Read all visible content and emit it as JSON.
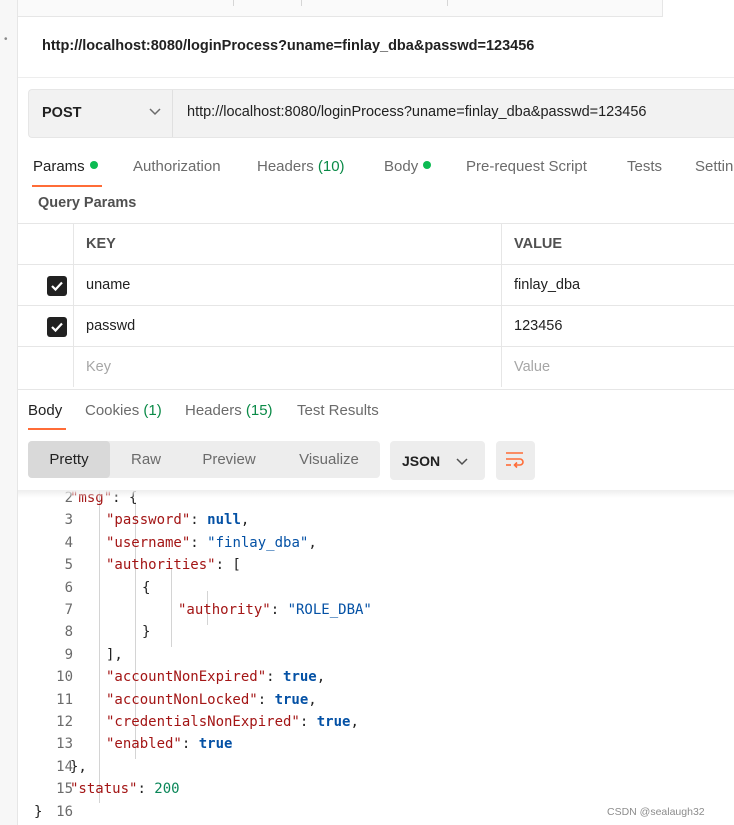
{
  "page": {
    "title_url": "http://localhost:8080/loginProcess?uname=finlay_dba&passwd=123456"
  },
  "request": {
    "method": "POST",
    "url": "http://localhost:8080/loginProcess?uname=finlay_dba&passwd=123456"
  },
  "request_tabs": {
    "params": "Params",
    "authorization": "Authorization",
    "headers": "Headers",
    "headers_count": "(10)",
    "body": "Body",
    "prerequest": "Pre-request Script",
    "tests": "Tests",
    "settings": "Settings"
  },
  "query_params": {
    "label": "Query Params",
    "key_header": "KEY",
    "value_header": "VALUE",
    "rows": [
      {
        "key": "uname",
        "value": "finlay_dba",
        "checked": true
      },
      {
        "key": "passwd",
        "value": "123456",
        "checked": true
      }
    ],
    "key_placeholder": "Key",
    "value_placeholder": "Value"
  },
  "response_tabs": {
    "body": "Body",
    "cookies": "Cookies",
    "cookies_count": "(1)",
    "headers": "Headers",
    "headers_count": "(15)",
    "test_results": "Test Results"
  },
  "view_modes": [
    "Pretty",
    "Raw",
    "Preview",
    "Visualize"
  ],
  "format": "JSON",
  "code_lines": [
    {
      "n": "2",
      "tokens": [
        {
          "c": "key",
          "t": "\"msg\""
        },
        {
          "c": "punc",
          "t": ": {"
        }
      ]
    },
    {
      "n": "3",
      "tokens": [
        {
          "c": "key",
          "t": "\"password\""
        },
        {
          "c": "punc",
          "t": ": "
        },
        {
          "c": "kw",
          "t": "null"
        },
        {
          "c": "punc",
          "t": ","
        }
      ]
    },
    {
      "n": "4",
      "tokens": [
        {
          "c": "key",
          "t": "\"username\""
        },
        {
          "c": "punc",
          "t": ": "
        },
        {
          "c": "str",
          "t": "\"finlay_dba\""
        },
        {
          "c": "punc",
          "t": ","
        }
      ]
    },
    {
      "n": "5",
      "tokens": [
        {
          "c": "key",
          "t": "\"authorities\""
        },
        {
          "c": "punc",
          "t": ": ["
        }
      ]
    },
    {
      "n": "6",
      "tokens": [
        {
          "c": "punc",
          "t": "{"
        }
      ]
    },
    {
      "n": "7",
      "tokens": [
        {
          "c": "key",
          "t": "\"authority\""
        },
        {
          "c": "punc",
          "t": ": "
        },
        {
          "c": "str",
          "t": "\"ROLE_DBA\""
        }
      ]
    },
    {
      "n": "8",
      "tokens": [
        {
          "c": "punc",
          "t": "}"
        }
      ]
    },
    {
      "n": "9",
      "tokens": [
        {
          "c": "punc",
          "t": "],"
        }
      ]
    },
    {
      "n": "10",
      "tokens": [
        {
          "c": "key",
          "t": "\"accountNonExpired\""
        },
        {
          "c": "punc",
          "t": ": "
        },
        {
          "c": "kw",
          "t": "true"
        },
        {
          "c": "punc",
          "t": ","
        }
      ]
    },
    {
      "n": "11",
      "tokens": [
        {
          "c": "key",
          "t": "\"accountNonLocked\""
        },
        {
          "c": "punc",
          "t": ": "
        },
        {
          "c": "kw",
          "t": "true"
        },
        {
          "c": "punc",
          "t": ","
        }
      ]
    },
    {
      "n": "12",
      "tokens": [
        {
          "c": "key",
          "t": "\"credentialsNonExpired\""
        },
        {
          "c": "punc",
          "t": ": "
        },
        {
          "c": "kw",
          "t": "true"
        },
        {
          "c": "punc",
          "t": ","
        }
      ]
    },
    {
      "n": "13",
      "tokens": [
        {
          "c": "key",
          "t": "\"enabled\""
        },
        {
          "c": "punc",
          "t": ": "
        },
        {
          "c": "kw",
          "t": "true"
        }
      ]
    },
    {
      "n": "14",
      "tokens": [
        {
          "c": "punc",
          "t": "},"
        }
      ]
    },
    {
      "n": "15",
      "tokens": [
        {
          "c": "key",
          "t": "\"status\""
        },
        {
          "c": "punc",
          "t": ": "
        },
        {
          "c": "num",
          "t": "200"
        }
      ]
    },
    {
      "n": "16",
      "tokens": [
        {
          "c": "punc",
          "t": "}"
        }
      ]
    }
  ],
  "watermark": "CSDN @sealaugh32",
  "colors": {
    "accent": "#ff6c37",
    "status_dot": "#0cbb52"
  }
}
